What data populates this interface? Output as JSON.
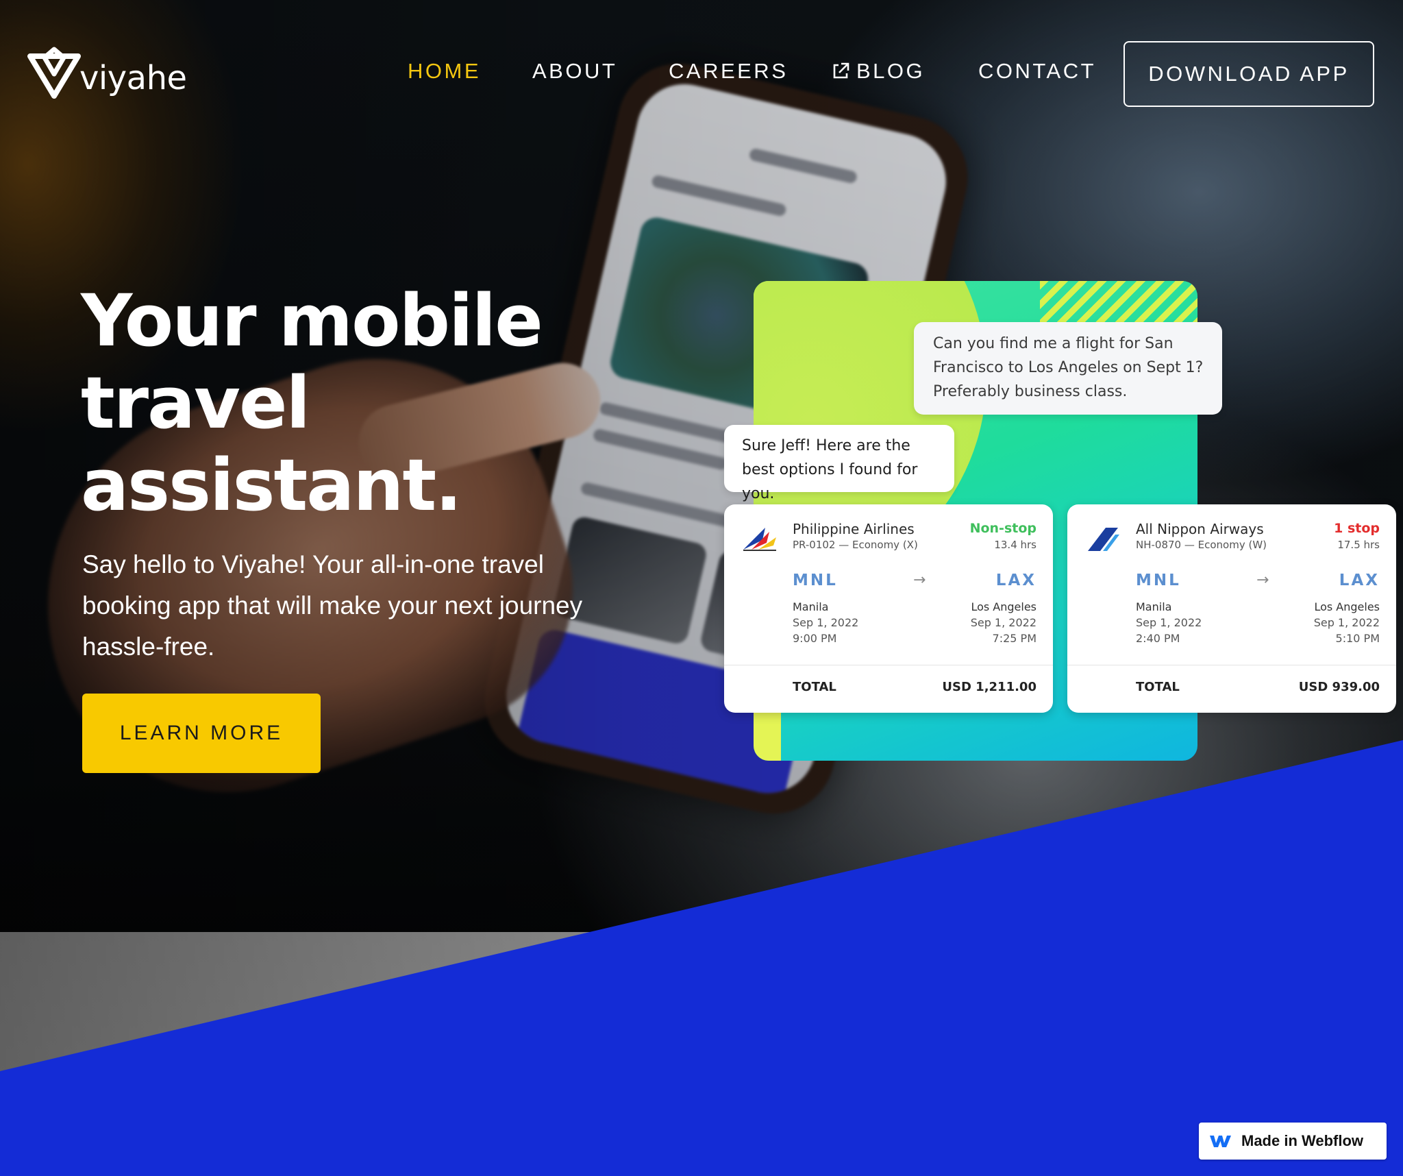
{
  "brand": {
    "name": "viyahe",
    "accent_color": "#f5c710",
    "blue_color": "#142cd6"
  },
  "nav": {
    "items": [
      {
        "label": "HOME",
        "active": true
      },
      {
        "label": "ABOUT",
        "active": false
      },
      {
        "label": "CAREERS",
        "active": false
      },
      {
        "label": "BLOG",
        "active": false,
        "icon": "external-link-icon"
      },
      {
        "label": "CONTACT",
        "active": false
      }
    ],
    "download_label": "DOWNLOAD APP"
  },
  "hero": {
    "title": "Your mobile travel assistant.",
    "subtitle": "Say hello to Viyahe! Your all-in-one travel booking app that will make your next journey hassle-free.",
    "cta_label": "LEARN MORE"
  },
  "chat": {
    "user_message": "Can you find me a flight for San Francisco to Los Angeles on Sept 1? Preferably business class.",
    "bot_message": "Sure Jeff! Here are the best options I found for you."
  },
  "flights": [
    {
      "airline": "Philippine Airlines",
      "code": "PR-0102 — Economy (X)",
      "stops": "Non-stop",
      "duration": "13.4 hrs",
      "from_code": "MNL",
      "to_code": "LAX",
      "from_city": "Manila",
      "to_city": "Los Angeles",
      "from_date": "Sep 1, 2022",
      "to_date": "Sep 1, 2022",
      "from_time": "9:00 PM",
      "to_time": "7:25 PM",
      "total_label": "TOTAL",
      "total_value": "USD 1,211.00"
    },
    {
      "airline": "All Nippon Airways",
      "code": "NH-0870 — Economy (W)",
      "stops": "1 stop",
      "duration": "17.5 hrs",
      "from_code": "MNL",
      "to_code": "LAX",
      "from_city": "Manila",
      "to_city": "Los Angeles",
      "from_date": "Sep 1, 2022",
      "to_date": "Sep 1, 2022",
      "from_time": "2:40 PM",
      "to_time": "5:10 PM",
      "total_label": "TOTAL",
      "total_value": "USD 939.00"
    }
  ],
  "arrow_glyph": "→",
  "badge": {
    "label": "Made in Webflow",
    "icon": "webflow-icon"
  }
}
